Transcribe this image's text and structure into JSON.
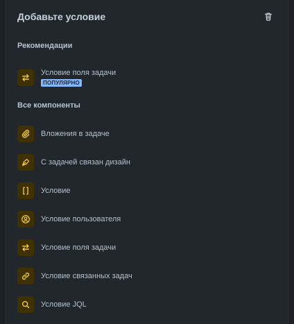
{
  "header": {
    "title": "Добавьте условие"
  },
  "recommendations": {
    "title": "Рекомендации",
    "items": [
      {
        "label": "Условие поля задачи",
        "badge": "ПОПУЛЯРНО",
        "icon": "swap-icon"
      }
    ]
  },
  "components": {
    "title": "Все компоненты",
    "items": [
      {
        "label": "Вложения в задаче",
        "icon": "paperclip-icon"
      },
      {
        "label": "С задачей связан дизайн",
        "icon": "pen-tool-icon"
      },
      {
        "label": "Условие",
        "icon": "braces-icon"
      },
      {
        "label": "Условие пользователя",
        "icon": "user-circle-icon"
      },
      {
        "label": "Условие поля задачи",
        "icon": "swap-icon"
      },
      {
        "label": "Условие связанных задач",
        "icon": "link-icon"
      },
      {
        "label": "Условие JQL",
        "icon": "search-icon"
      }
    ]
  },
  "colors": {
    "icon_accent": "#f5cd47",
    "icon_bg": "#3f3102",
    "badge_bg": "#85b8ff"
  }
}
